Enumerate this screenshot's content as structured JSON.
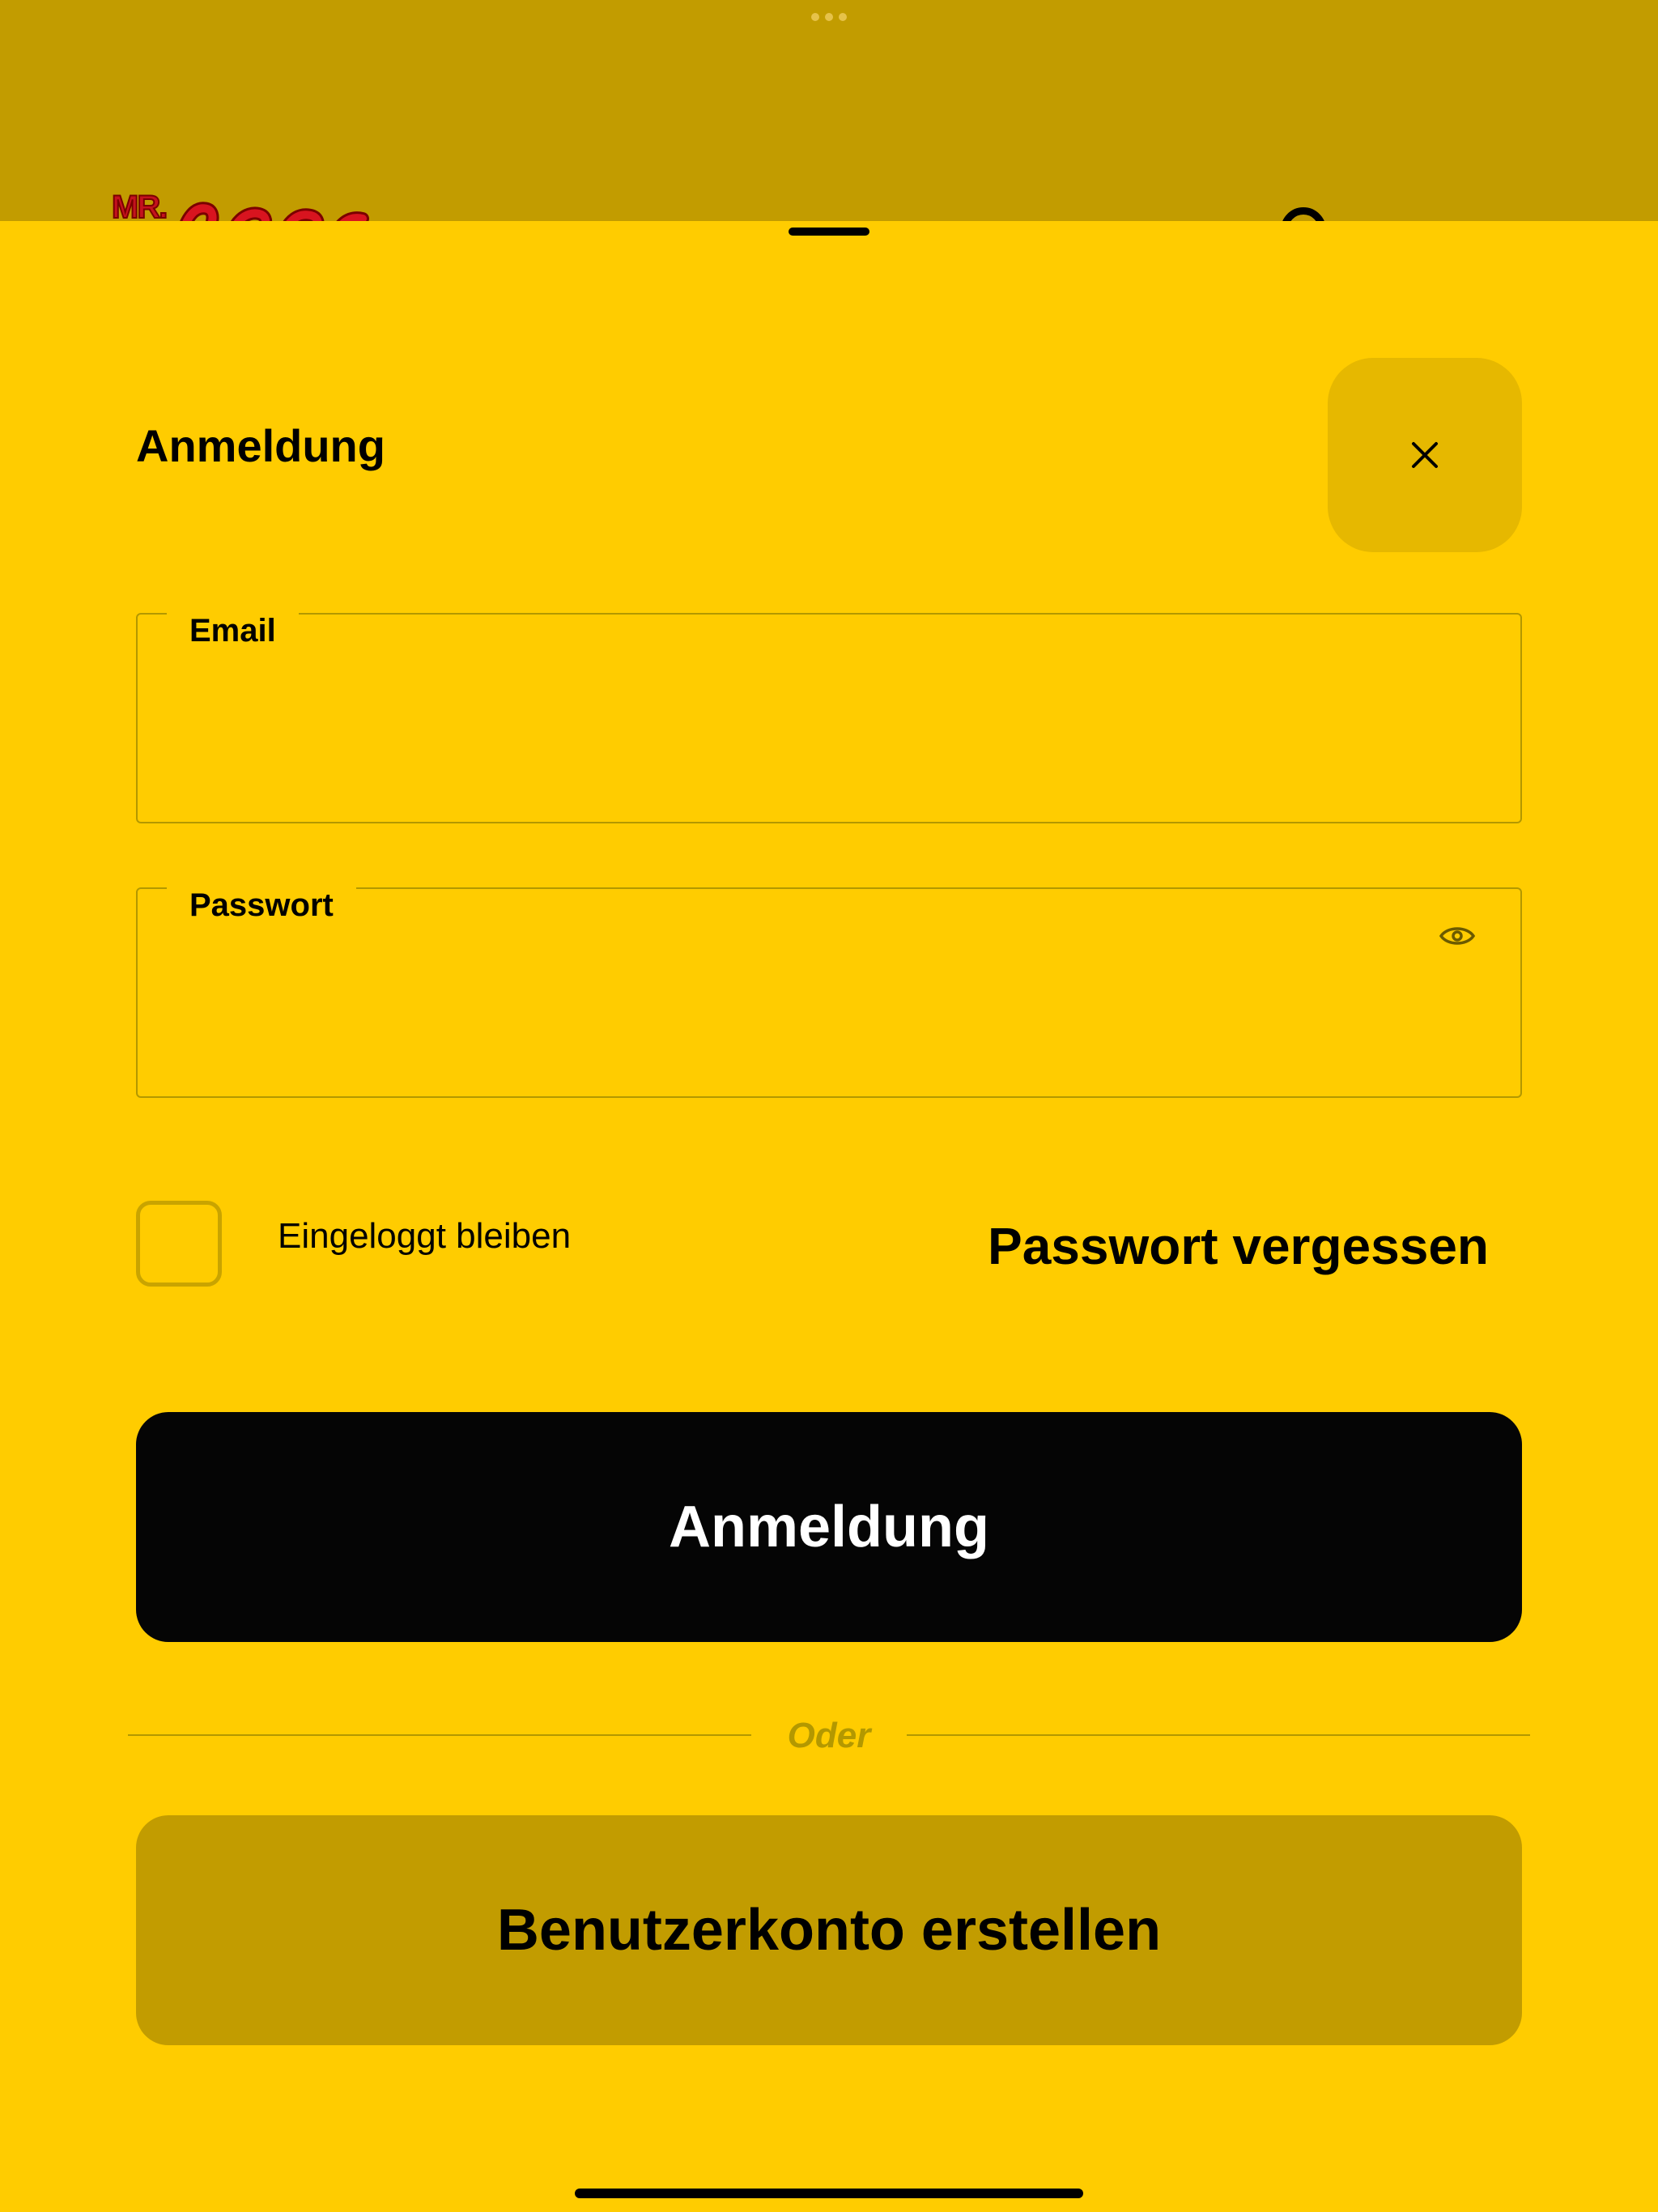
{
  "background": {
    "logo": {
      "prefix": "MR.",
      "script_text": "Jackson"
    },
    "colors": {
      "backdrop": "#c29c00",
      "logo_red": "#c4121e"
    }
  },
  "login_sheet": {
    "title": "Anmeldung",
    "close_icon": "close-icon",
    "fields": {
      "email": {
        "label": "Email",
        "value": ""
      },
      "password": {
        "label": "Passwort",
        "value": "",
        "toggle_icon": "eye-icon"
      }
    },
    "remember_me": {
      "label": "Eingeloggt bleiben",
      "checked": false
    },
    "forgot_password": "Passwort vergessen",
    "login_button": "Anmeldung",
    "divider_text": "Oder",
    "register_button": "Benutzerkonto erstellen",
    "colors": {
      "sheet": "#ffcc00",
      "close_button": "#e6b800",
      "primary_button": "#050505",
      "secondary_button": "#c29c00"
    }
  }
}
